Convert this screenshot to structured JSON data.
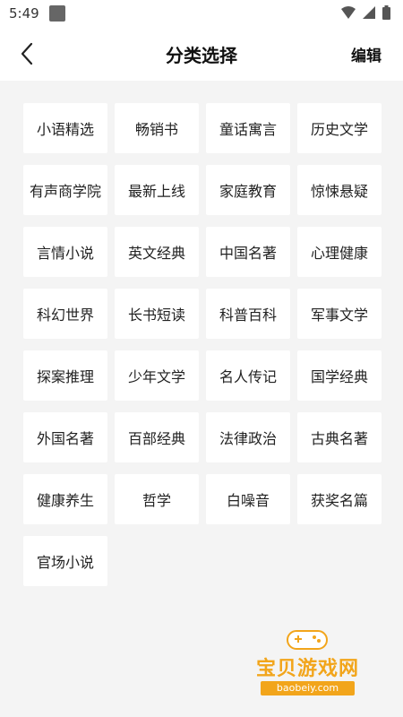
{
  "status_bar": {
    "time": "5:49"
  },
  "header": {
    "title": "分类选择",
    "edit_label": "编辑"
  },
  "categories": [
    "小语精选",
    "畅销书",
    "童话寓言",
    "历史文学",
    "有声商学院",
    "最新上线",
    "家庭教育",
    "惊悚悬疑",
    "言情小说",
    "英文经典",
    "中国名著",
    "心理健康",
    "科幻世界",
    "长书短读",
    "科普百科",
    "军事文学",
    "探案推理",
    "少年文学",
    "名人传记",
    "国学经典",
    "外国名著",
    "百部经典",
    "法律政治",
    "古典名著",
    "健康养生",
    "哲学",
    "白噪音",
    "获奖名篇",
    "官场小说"
  ],
  "watermark": {
    "text": "宝贝游戏网",
    "url": "baobeiy.com"
  },
  "colors": {
    "background": "#f4f4f4",
    "tile": "#ffffff",
    "watermark": "#f2a51b"
  }
}
